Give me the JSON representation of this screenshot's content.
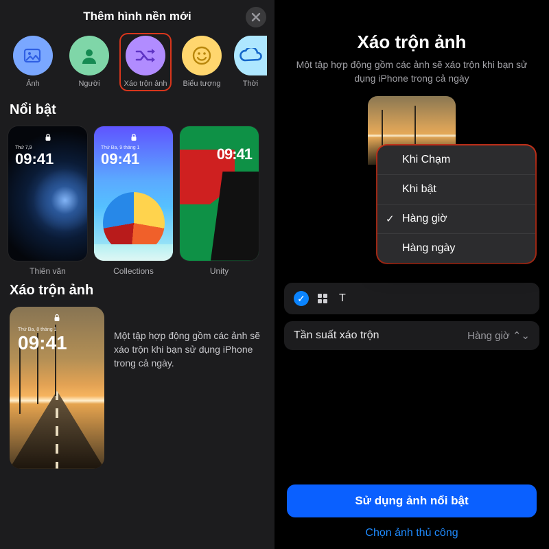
{
  "left": {
    "header_title": "Thêm hình nền mới",
    "categories": [
      {
        "label": "Ảnh"
      },
      {
        "label": "Người"
      },
      {
        "label": "Xáo trộn ảnh"
      },
      {
        "label": "Biểu tượng"
      },
      {
        "label": "Thời"
      }
    ],
    "featured": {
      "section_title": "Nổi bật",
      "cards": [
        {
          "caption": "Thiên văn",
          "date": "Thứ 7,9",
          "time": "09:41"
        },
        {
          "caption": "Collections",
          "date": "Thứ Ba, 9 tháng 1",
          "time": "09:41"
        },
        {
          "caption": "Unity",
          "date": "",
          "time": "09:41"
        }
      ]
    },
    "shuffle": {
      "section_title": "Xáo trộn ảnh",
      "card": {
        "date": "Thứ Ba, 8 tháng 1",
        "time": "09:41"
      },
      "description": "Một tập hợp động gồm các ảnh sẽ xáo trộn khi bạn sử dụng iPhone trong cả ngày."
    }
  },
  "right": {
    "title": "Xáo trộn ảnh",
    "subtitle": "Một tập hợp động gồm các ảnh sẽ xáo trộn khi bạn sử dụng iPhone trong cả ngày",
    "popup": {
      "items": [
        {
          "label": "Khi Chạm",
          "checked": false
        },
        {
          "label": "Khi bật",
          "checked": false
        },
        {
          "label": "Hàng giờ",
          "checked": true
        },
        {
          "label": "Hàng ngày",
          "checked": false
        }
      ]
    },
    "rows": {
      "all_label": "T",
      "freq_label": "Tần suất xáo trộn",
      "freq_value": "Hàng giờ"
    },
    "cta_primary": "Sử dụng ảnh nổi bật",
    "cta_link": "Chọn ảnh thủ công"
  }
}
